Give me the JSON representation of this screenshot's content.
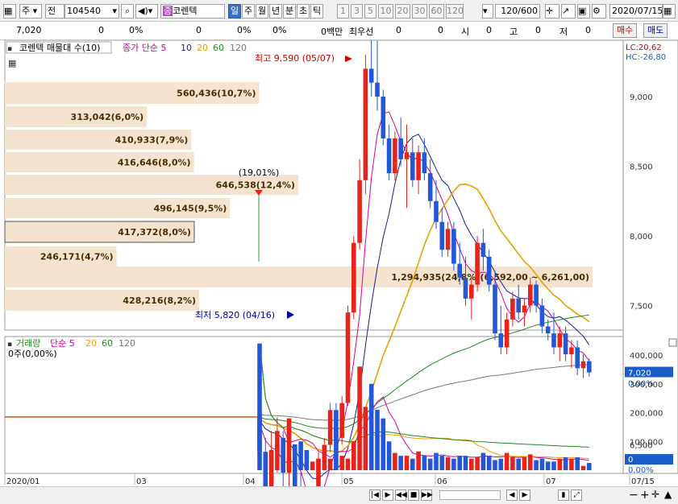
{
  "toolbar": {
    "type": "주",
    "market": "전",
    "code": "104540",
    "badge": "종",
    "name": "코렌텍",
    "periods": [
      "일",
      "주",
      "월",
      "년",
      "분",
      "초",
      "틱"
    ],
    "active_period": "일",
    "nums": [
      "1",
      "3",
      "5",
      "10",
      "20",
      "30",
      "60",
      "120"
    ],
    "count": "120/600",
    "date": "2020/07/15"
  },
  "quote": {
    "price": "7,020",
    "v1": "0",
    "p1": "0%",
    "v2": "0",
    "p2": "0%",
    "p3": "0%",
    "unit": "0백만",
    "best": "최우선",
    "bid": "0",
    "bid2": "0",
    "open_l": "시",
    "open": "0",
    "high_l": "고",
    "high": "0",
    "low_l": "저",
    "low": "0",
    "buy": "매수",
    "sell": "매도"
  },
  "price_panel": {
    "title": "코렌텍 매물대 수(10)",
    "ma_label": "종가 단순 5",
    "ma_periods": [
      "5",
      "10",
      "20",
      "60",
      "120"
    ],
    "lc": "LC:20,62",
    "hc": "HC:-26,80",
    "high_note": "최고 9,590 (05/07)",
    "low_note": "최저 5,820 (04/16)",
    "marker_note": "(19,01%)",
    "cur_price": "7,020",
    "cur_pct": "0,00%",
    "axis": [
      "9,000",
      "8,500",
      "8,000",
      "7,500",
      "6,500",
      "6,000"
    ]
  },
  "volume_profile": [
    {
      "label": "560,436(10,7%)",
      "value": 560436
    },
    {
      "label": "313,042(6,0%)",
      "value": 313042
    },
    {
      "label": "410,933(7,9%)",
      "value": 410933
    },
    {
      "label": "416,646(8,0%)",
      "value": 416646
    },
    {
      "label": "646,538(12,4%)",
      "value": 646538
    },
    {
      "label": "496,145(9,5%)",
      "value": 496145
    },
    {
      "label": "417,372(8,0%)",
      "value": 417372
    },
    {
      "label": "246,171(4,7%)",
      "value": 246171
    },
    {
      "label": "1,294,935(24,8%)(6,592,00 ~ 6,261,00)",
      "value": 1294935
    },
    {
      "label": "428,216(8,2%)",
      "value": 428216
    }
  ],
  "volume_panel": {
    "title": "거래량",
    "ma_label": "단순 5",
    "ma_periods": [
      "5",
      "20",
      "60",
      "120"
    ],
    "zero_label": "0주(0,00%)",
    "axis": [
      "400,000",
      "300,000",
      "200,000",
      "100,000"
    ],
    "cur_val": "0",
    "cur_pct": "0,00%"
  },
  "x_axis": [
    "2020/01",
    "03",
    "04",
    "05",
    "06",
    "07",
    "07/15"
  ],
  "colors": {
    "up": "#e8231c",
    "down": "#2456d8",
    "profile": "#f4e4cf",
    "ma5": "#d4009a",
    "ma10": "#1c1c8a",
    "ma20": "#e8a000",
    "ma60": "#1f8a1f",
    "ma120": "#777777"
  }
}
